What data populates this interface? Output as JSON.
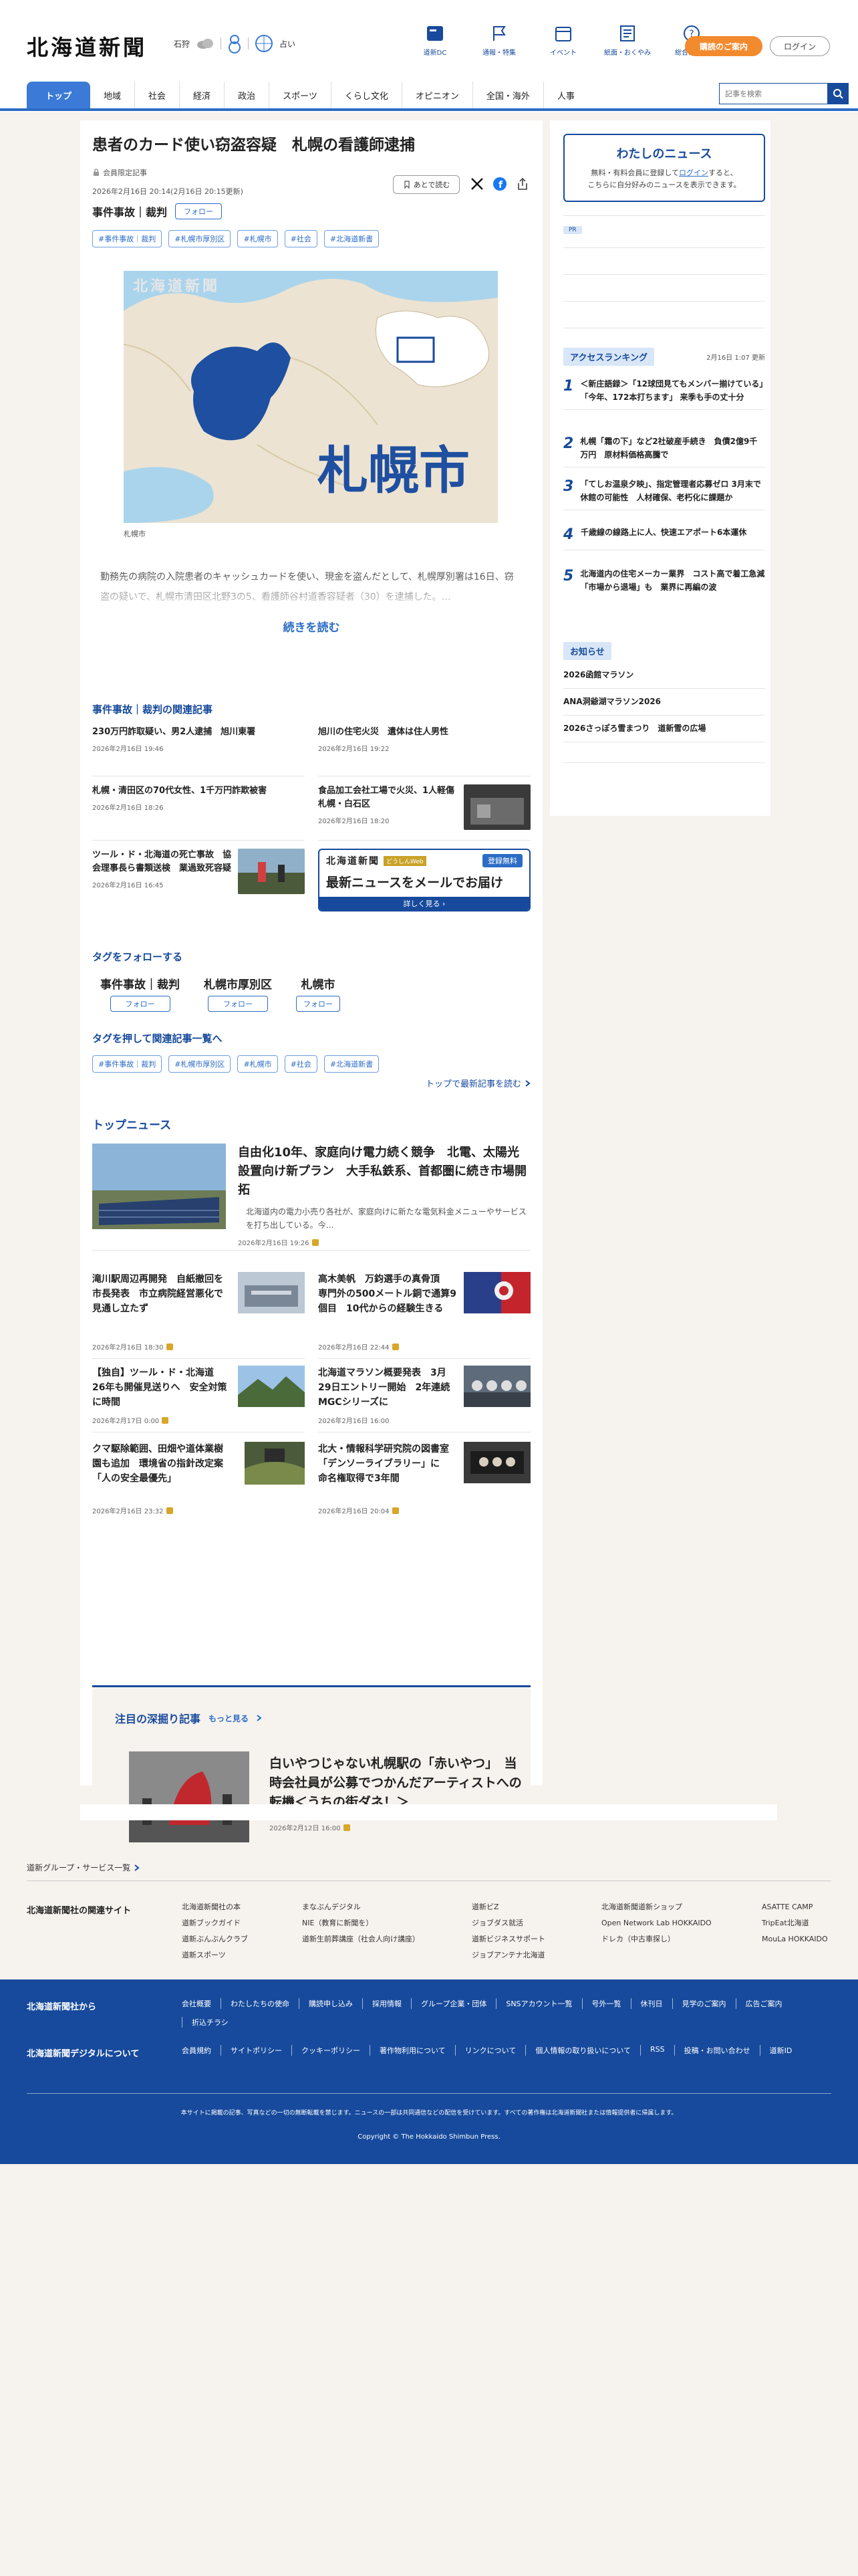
{
  "header": {
    "logo": "北海道新聞",
    "weather": {
      "city": "石狩",
      "fortune_label": "占い"
    },
    "icons": [
      {
        "label": "道新DC",
        "icon": "newspaper-icon"
      },
      {
        "label": "通報・特集",
        "icon": "flag-icon"
      },
      {
        "label": "イベント",
        "icon": "calendar-icon"
      },
      {
        "label": "紙面・おくやみ",
        "icon": "paper-icon"
      },
      {
        "label": "総合ガイド",
        "icon": "help-icon"
      }
    ],
    "subscribe": "購読のご案内",
    "login": "ログイン",
    "search_placeholder": "記事を検索"
  },
  "nav": [
    "トップ",
    "地域",
    "社会",
    "経済",
    "政治",
    "スポーツ",
    "くらし文化",
    "オピニオン",
    "全国・海外",
    "人事"
  ],
  "article": {
    "title": "患者のカード使い窃盗容疑　札幌の看護師逮捕",
    "badge": "会員限定記事",
    "dates": "2026年2月16日 20:14(2月16日 20:15更新)",
    "save": "あとで読む",
    "category": "事件事故｜裁判",
    "follow": "フォロー",
    "tags": [
      "#事件事故｜裁判",
      "#札幌市厚別区",
      "#札幌市",
      "#社会",
      "#北海道新書"
    ],
    "map_city": "札幌市",
    "map_watermark": "北海道新聞",
    "caption": "札幌市",
    "lede": "勤務先の病院の入院患者のキャッシュカードを使い、現金を盗んだとして、札幌厚別署は16日、窃盗の疑いで、札幌市清田区北野3の5、看護師谷村道香容疑者（30）を逮捕した。…",
    "read_more": "続きを読む"
  },
  "related": {
    "title": "事件事故｜裁判の関連記事",
    "items": [
      {
        "title": "230万円詐取疑い、男2人逮捕　旭川東署",
        "date": "2026年2月16日 19:46"
      },
      {
        "title": "旭川の住宅火災　遺体は住人男性",
        "date": "2026年2月16日 19:22"
      },
      {
        "title": "札幌・清田区の70代女性、1千万円詐欺被害",
        "date": "2026年2月16日 18:26"
      },
      {
        "title": "食品加工会社工場で火災、1人軽傷　札幌・白石区",
        "date": "2026年2月16日 18:20"
      },
      {
        "title": "ツール・ド・北海道の死亡事故　協会理事長ら書類送検　業過致死容疑",
        "date": "2026年2月16日 16:45"
      }
    ],
    "promo": {
      "logo": "北海道新聞",
      "badge": "どうしんWeb",
      "free": "登録無料",
      "main": "最新ニュースをメールでお届け",
      "bar": "詳しく見る ›"
    }
  },
  "follow_tags": {
    "title": "タグをフォローする",
    "items": [
      "事件事故｜裁判",
      "札幌市厚別区",
      "札幌市"
    ],
    "button": "フォロー"
  },
  "tag_list": {
    "title": "タグを押して関連記事一覧へ",
    "items": [
      "#事件事故｜裁判",
      "#札幌市厚別区",
      "#札幌市",
      "#社会",
      "#北海道新書"
    ],
    "to_top": "トップで最新記事を読む"
  },
  "top_news": {
    "title": "トップニュース",
    "lead": {
      "title": "自由化10年、家庭向け電力続く競争　北電、太陽光設置向け新プラン　大手私鉄系、首都圏に続き市場開拓",
      "summary": "北海道内の電力小売り各社が、家庭向けに新たな電気料金メニューやサービスを打ち出している。今…",
      "date": "2026年2月16日 19:26"
    },
    "items": [
      {
        "title": "滝川駅周辺再開発　自紙撤回を市長発表　市立病院経営悪化で見通し立たず",
        "date": "2026年2月16日 18:30"
      },
      {
        "title": "高木美帆　万鈞選手の真骨頂　専門外の500メートル銅で通算9個目　10代からの経験生きる",
        "date": "2026年2月16日 22:44"
      },
      {
        "title": "【独自】ツール・ド・北海道　26年も開催見送りへ　安全対策に時間",
        "date": "2026年2月17日 0:00"
      },
      {
        "title": "北海道マラソン概要発表　3月29日エントリー開始　2年連続MGCシリーズに",
        "date": "2026年2月16日 16:00"
      },
      {
        "title": "クマ駆除範囲、田畑や道体業樹園も追加　環境省の指針改定案　「人の安全最優先」",
        "date": "2026年2月16日 23:32"
      },
      {
        "title": "北大・情報科学研究院の図書室「デンソーライブラリー」に　命名権取得で3年間",
        "date": "2026年2月16日 20:04"
      }
    ]
  },
  "deep": {
    "heading": "注目の深掘り記事",
    "more": "もっと見る",
    "title": "白いやつじゃない札幌駅の「赤いやつ」　当時会社員が公募でつかんだアーティストへの転機＜うちの街ダネ！＞",
    "date": "2026年2月12日 16:00"
  },
  "sidebar": {
    "my_news": {
      "title": "わたしのニュース",
      "text_1": "無料・有料会員に登録してログインすると、",
      "link": "ログイン",
      "text_2": "こちらに自分好みのニュースを表示できます。",
      "text_pre": "無料・有料会員に登録して"
    },
    "pr": "PR",
    "ranking": {
      "title": "アクセスランキング",
      "updated": "2月16日 1:07 更新",
      "items": [
        "＜新庄語録＞「12球団見てもメンバー揃けている」「今年、172本打ちます」 来季も手の丈十分",
        "札幌「霜の下」など2社破産手続き　負債2億9千万円　原材料価格高騰で",
        "「てしお温泉夕映」、指定管理者応募ゼロ 3月末で休館の可能性　人材確保、老朽化に課題か",
        "千歳線の線路上に人、快速エアポート6本運休",
        "北海道内の住宅メーカー業界　コスト高で着工急減「市場から退場」も　業界に再編の波"
      ]
    },
    "notice": {
      "title": "お知らせ",
      "items": [
        "2026函館マラソン",
        "ANA洞爺湖マラソン2026",
        "2026さっぽろ雪まつり　道新雪の広場"
      ]
    }
  },
  "footer": {
    "group": "道新グループ・サービス一覧",
    "sites_title": "北海道新聞社の関連サイト",
    "sites": [
      [
        "北海道新聞社の本",
        "道新ブックガイド",
        "道新ぶんぶんクラブ",
        "道新スポーツ"
      ],
      [
        "まなぶんデジタル",
        "NIE（教育に新聞を）",
        "道新生前葬講座（社会人向け講座）"
      ],
      [
        "道新ビZ",
        "ジョブダス就活",
        "道新ビジネスサポート",
        "ジョブアンテナ北海道"
      ],
      [
        "北海道新聞道新ショップ",
        "Open Network Lab HOKKAIDO",
        "ドレカ（中古車探し）"
      ],
      [
        "ASATTE CAMP",
        "TripEat北海道",
        "MouLa HOKKAIDO"
      ]
    ],
    "company_title": "北海道新聞社から",
    "company_links": [
      "会社概要",
      "わたしたちの使命",
      "購読申し込み",
      "採用情報",
      "グループ企業・団体",
      "SNSアカウント一覧",
      "号外一覧",
      "休刊日",
      "見学のご案内",
      "広告ご案内",
      "折込チラシ"
    ],
    "digital_title": "北海道新聞デジタルについて",
    "digital_links": [
      "会員規約",
      "サイトポリシー",
      "クッキーポリシー",
      "著作物利用について",
      "リンクについて",
      "個人情報の取り扱いについて",
      "RSS",
      "投稿・お問い合わせ",
      "道新ID"
    ],
    "note": "本サイトに掲載の記事、写真などの一切の無断転載を禁じます。ニュースの一部は共同通信などの配信を受けています。すべての著作権は北海道新聞社または情報提供者に帰属します。",
    "copyright": "Copyright © The Hokkaido Shimbun Press."
  },
  "colors": {
    "brand": "#174a9c",
    "accent": "#2c6cc6",
    "subscribe": "#f28a2e",
    "background": "#f6f2ee"
  }
}
